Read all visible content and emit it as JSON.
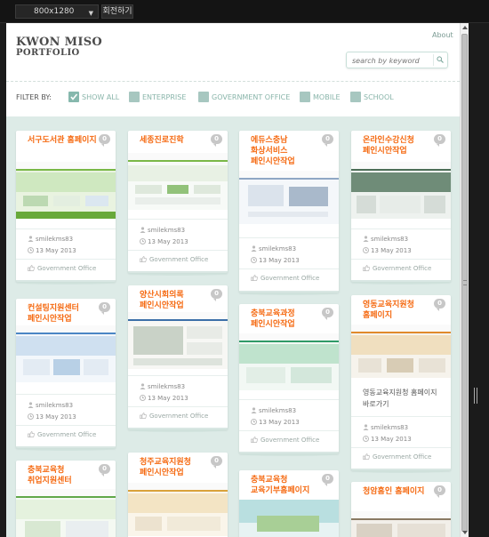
{
  "toolbar": {
    "device": "800x1280",
    "rotate": "회전하기"
  },
  "site": {
    "logo_line1": "KWON MISO",
    "logo_line2": "PORTFOLIO",
    "about": "About",
    "search_placeholder": "search by keyword"
  },
  "filters": {
    "label": "FILTER BY:",
    "items": [
      "SHOW ALL",
      "ENTERPRISE",
      "GOVERNMENT OFFICE",
      "MOBILE",
      "SCHOOL"
    ]
  },
  "colors": {
    "accent": "#f56a12",
    "teal": "#89b5aa",
    "grid_bg": "#ddebe7"
  },
  "cards": [
    {
      "title": "서구도서관 홈페이지",
      "count": "0",
      "author": "smilekms83",
      "date": "13 May 2013",
      "category": "Government Office"
    },
    {
      "title": "세종진로진학",
      "count": "0",
      "author": "smilekms83",
      "date": "13 May 2013",
      "category": "Government Office"
    },
    {
      "title": "에듀스충남 화상서비스 페인시안작업",
      "count": "0",
      "author": "smilekms83",
      "date": "13 May 2013",
      "category": "Government Office"
    },
    {
      "title": "온라인수강신청 페인시안작업",
      "count": "0",
      "author": "smilekms83",
      "date": "13 May 2013",
      "category": "Government Office"
    },
    {
      "title": "컨설팅지원센터 페인시안작업",
      "count": "0",
      "author": "smilekms83",
      "date": "13 May 2013",
      "category": "Government Office"
    },
    {
      "title": "양산시회의록 페인시안작업",
      "count": "0",
      "author": "smilekms83",
      "date": "13 May 2013",
      "category": "Government Office"
    },
    {
      "title": "충북교육과정 페인시안작업",
      "count": "0",
      "author": "smilekms83",
      "date": "13 May 2013",
      "category": "Government Office"
    },
    {
      "title": "영동교육지원청 홈페이지",
      "count": "0",
      "desc": "영동교육지원청 홈페이지 바로가기",
      "author": "smilekms83",
      "date": "13 May 2013",
      "category": "Government Office"
    },
    {
      "title": "충북교육청 취업지원센터",
      "count": "0"
    },
    {
      "title": "청주교육지원청 페인시안작업",
      "count": "0"
    },
    {
      "title": "충북교육청 교육기부홈페이지",
      "count": "0"
    },
    {
      "title": "청암홈인 홈페이지",
      "count": "0"
    }
  ]
}
